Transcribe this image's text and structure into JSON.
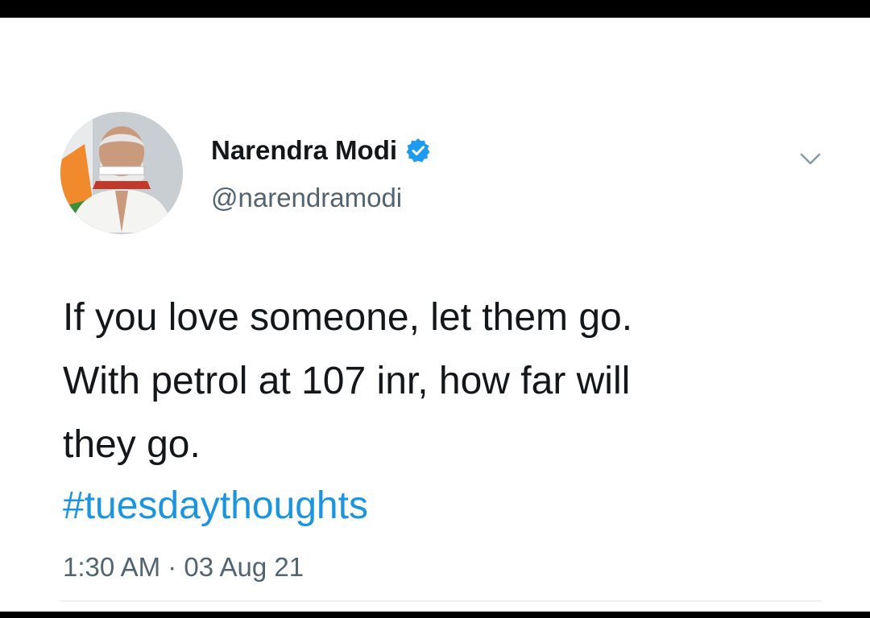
{
  "tweet": {
    "author": {
      "name": "Narendra Modi",
      "handle": "@narendramodi",
      "verified": true,
      "verified_icon": "verified-badge-icon",
      "avatar_icon": "profile-avatar"
    },
    "text_lines": [
      "If you love someone, let them go.",
      "With petrol at 107 inr, how far will",
      "they go."
    ],
    "hashtag": "#tuesdaythoughts",
    "timestamp": "1:30 AM · 03 Aug 21",
    "menu_icon": "chevron-down-icon"
  },
  "colors": {
    "text": "#14171a",
    "secondary_text": "#536471",
    "hashtag": "#1b95e0",
    "verified": "#1d9bf0",
    "bars": "#000000"
  }
}
